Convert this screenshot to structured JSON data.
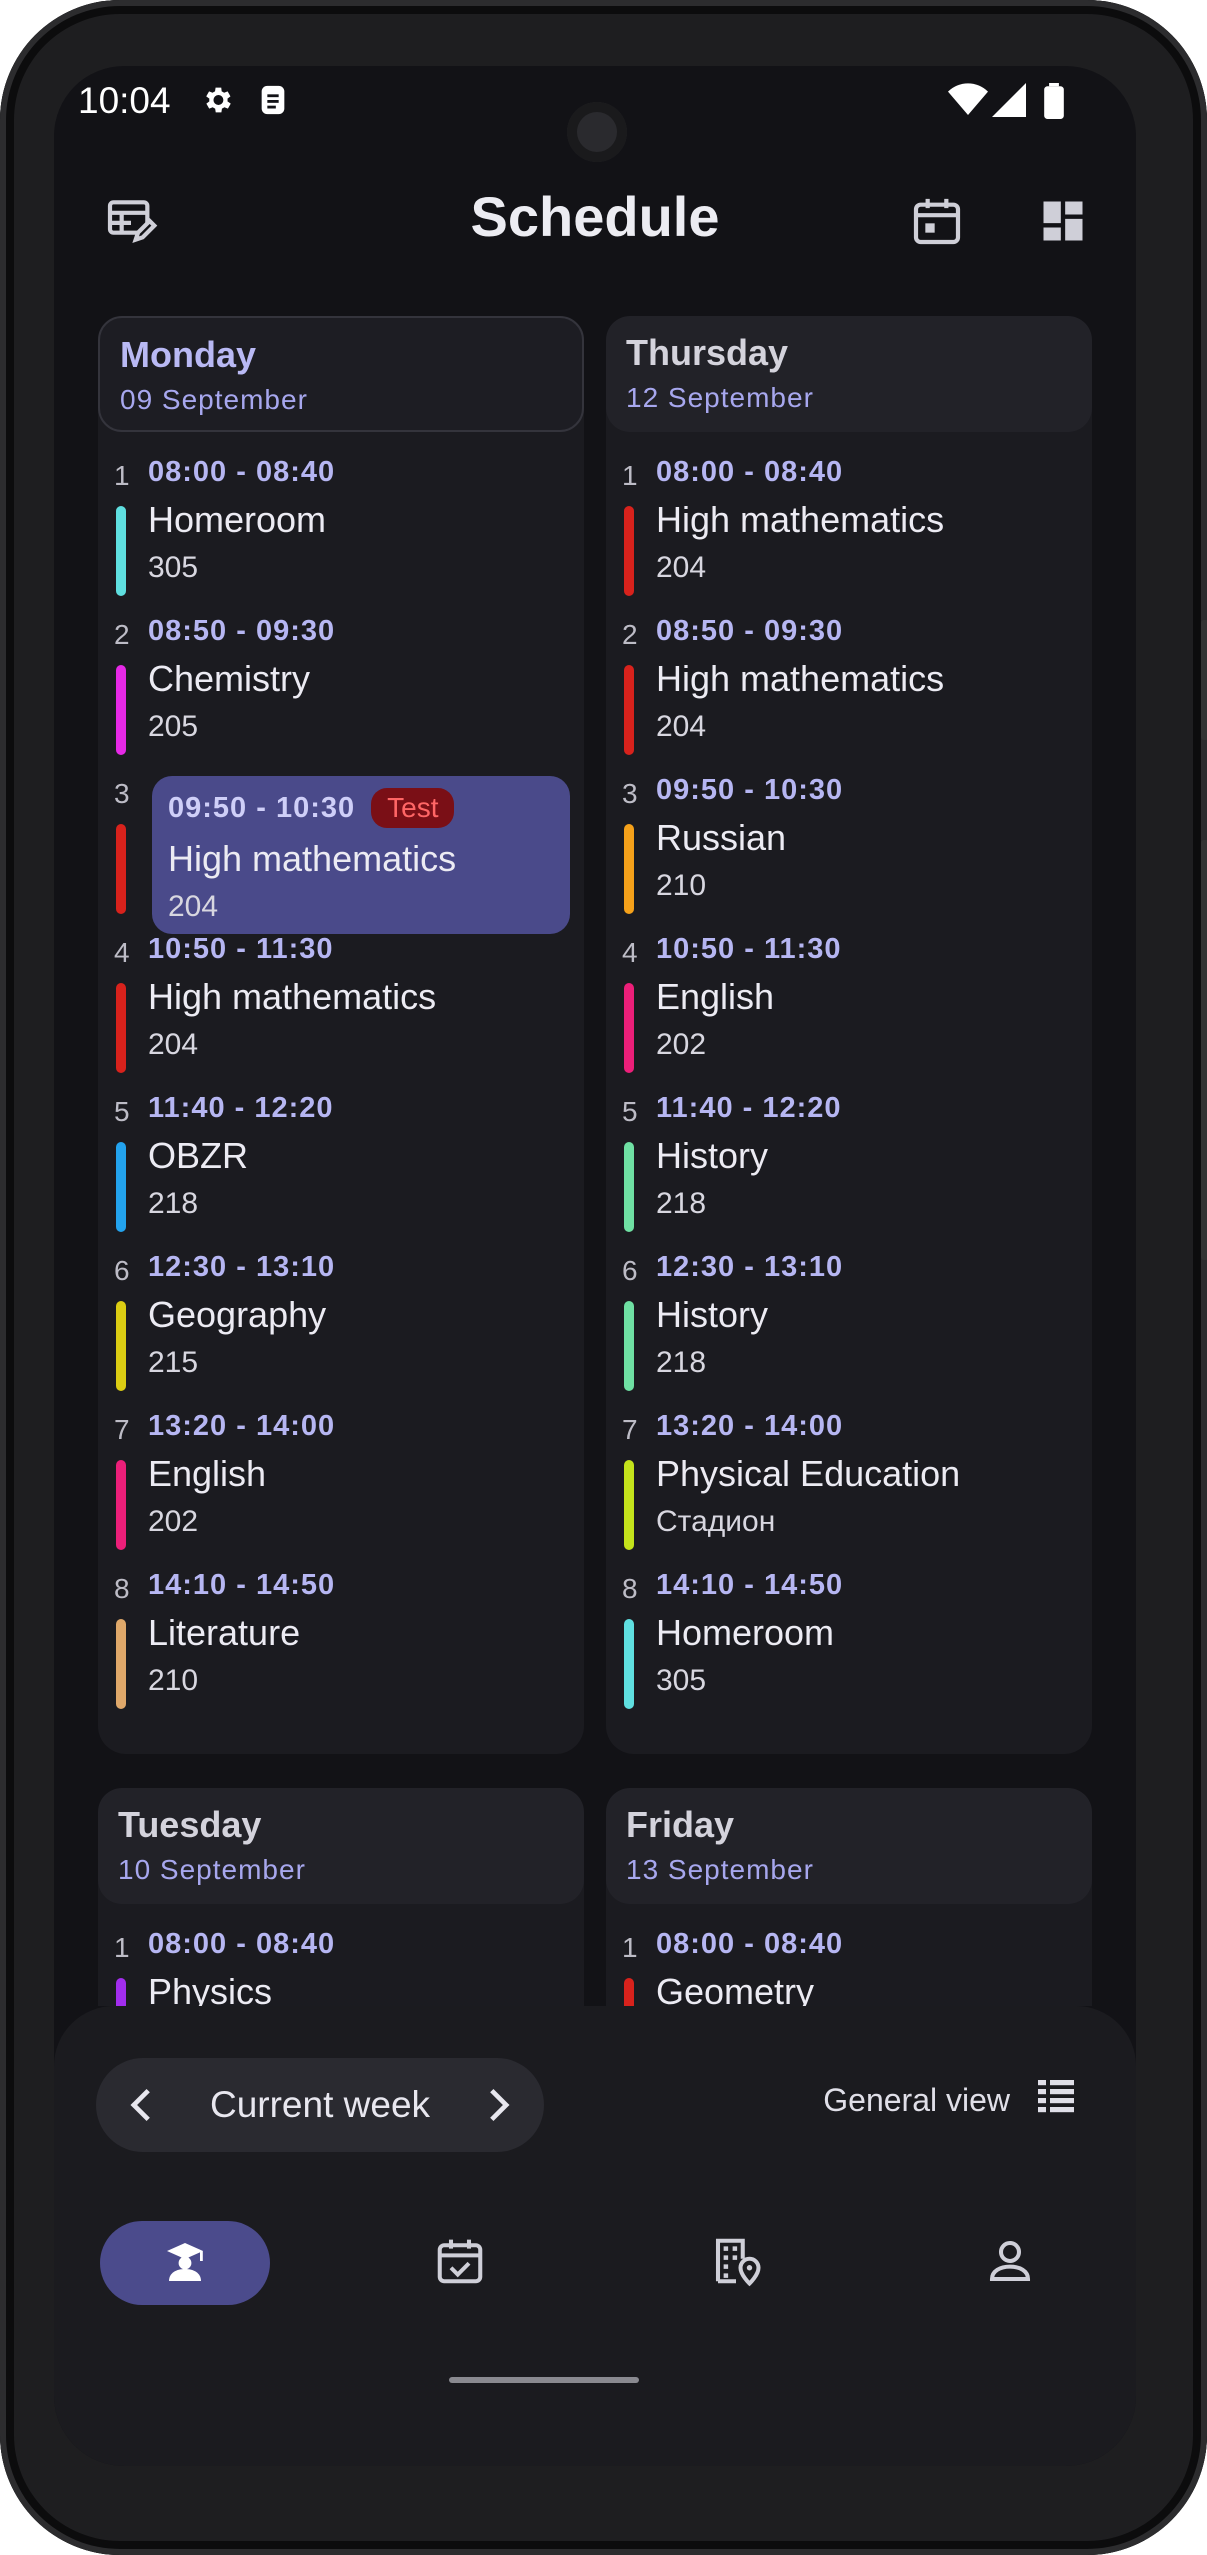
{
  "status": {
    "time": "10:04"
  },
  "header": {
    "title": "Schedule"
  },
  "days_left": [
    {
      "name": "Monday",
      "date": "09 September",
      "today": true,
      "lessons": [
        {
          "num": "1",
          "time": "08:00 - 08:40",
          "subject": "Homeroom",
          "room": "305",
          "color": "#5fdfe0"
        },
        {
          "num": "2",
          "time": "08:50 - 09:30",
          "subject": "Chemistry",
          "room": "205",
          "color": "#e629e6"
        },
        {
          "num": "3",
          "time": "09:50 - 10:30",
          "subject": "High mathematics",
          "room": "204",
          "color": "#d8221c",
          "active": true,
          "tag": "Test"
        },
        {
          "num": "4",
          "time": "10:50 - 11:30",
          "subject": "High mathematics",
          "room": "204",
          "color": "#d8221c"
        },
        {
          "num": "5",
          "time": "11:40 - 12:20",
          "subject": "OBZR",
          "room": "218",
          "color": "#23a3ee"
        },
        {
          "num": "6",
          "time": "12:30 - 13:10",
          "subject": "Geography",
          "room": "215",
          "color": "#dccd13"
        },
        {
          "num": "7",
          "time": "13:20 - 14:00",
          "subject": "English",
          "room": "202",
          "color": "#ec1f79"
        },
        {
          "num": "8",
          "time": "14:10 - 14:50",
          "subject": "Literature",
          "room": "210",
          "color": "#dfa86a"
        }
      ]
    },
    {
      "name": "Tuesday",
      "date": "10 September",
      "today": false,
      "lessons": [
        {
          "num": "1",
          "time": "08:00 - 08:40",
          "subject": "Physics",
          "room": "",
          "color": "#a22ded"
        }
      ]
    }
  ],
  "days_right": [
    {
      "name": "Thursday",
      "date": "12 September",
      "today": false,
      "lessons": [
        {
          "num": "1",
          "time": "08:00 - 08:40",
          "subject": "High mathematics",
          "room": "204",
          "color": "#d8221c"
        },
        {
          "num": "2",
          "time": "08:50 - 09:30",
          "subject": "High mathematics",
          "room": "204",
          "color": "#d8221c"
        },
        {
          "num": "3",
          "time": "09:50 - 10:30",
          "subject": "Russian",
          "room": "210",
          "color": "#f5a11a"
        },
        {
          "num": "4",
          "time": "10:50 - 11:30",
          "subject": "English",
          "room": "202",
          "color": "#ec1f79"
        },
        {
          "num": "5",
          "time": "11:40 - 12:20",
          "subject": "History",
          "room": "218",
          "color": "#6fe0a3"
        },
        {
          "num": "6",
          "time": "12:30 - 13:10",
          "subject": "History",
          "room": "218",
          "color": "#6fe0a3"
        },
        {
          "num": "7",
          "time": "13:20 - 14:00",
          "subject": "Physical Education",
          "room": "Стадион",
          "color": "#c4e31b"
        },
        {
          "num": "8",
          "time": "14:10 - 14:50",
          "subject": "Homeroom",
          "room": "305",
          "color": "#5fdfe0"
        }
      ]
    },
    {
      "name": "Friday",
      "date": "13 September",
      "today": false,
      "lessons": [
        {
          "num": "1",
          "time": "08:00 - 08:40",
          "subject": "Geometry",
          "room": "",
          "color": "#d8221c"
        }
      ]
    }
  ],
  "week_nav": {
    "label": "Current week"
  },
  "view_toggle": {
    "label": "General view"
  },
  "bottom_nav": [
    "schedule-icon",
    "tasks-icon",
    "buildings-icon",
    "profile-icon"
  ]
}
